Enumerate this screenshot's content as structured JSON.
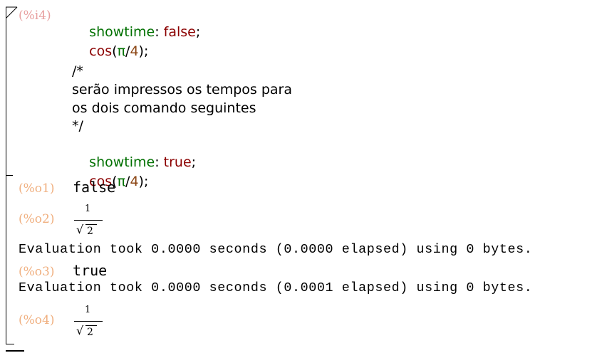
{
  "input": {
    "label": "(%i4)",
    "lines": [
      {
        "fn": "showtime",
        "sep": ": ",
        "val": "false",
        "end": ";"
      },
      {
        "fn": "cos",
        "open": "(",
        "pi": "π",
        "slash": "/",
        "num": "4",
        "close": ");"
      },
      {
        "comment": "/*"
      },
      {
        "comment": "serão impressos os tempos para"
      },
      {
        "comment": "os dois comando seguintes"
      },
      {
        "comment": "*/"
      },
      {
        "fn": "showtime",
        "sep": ": ",
        "val": "true",
        "end": ";"
      },
      {
        "fn": "cos",
        "open": "(",
        "pi": "π",
        "slash": "/",
        "num": "4",
        "close": ");"
      }
    ]
  },
  "outputs": [
    {
      "label": "(%o1)",
      "text": "false"
    },
    {
      "label": "(%o2)",
      "numerator": "1",
      "radicand": "2",
      "radical": "√"
    },
    {
      "eval": "Evaluation took 0.0000 seconds (0.0000 elapsed) using 0 bytes."
    },
    {
      "label": "(%o3)",
      "text": "true"
    },
    {
      "eval": "Evaluation took 0.0000 seconds (0.0001 elapsed) using 0 bytes."
    },
    {
      "label": "(%o4)",
      "numerator": "1",
      "radicand": "2",
      "radical": "√"
    }
  ]
}
